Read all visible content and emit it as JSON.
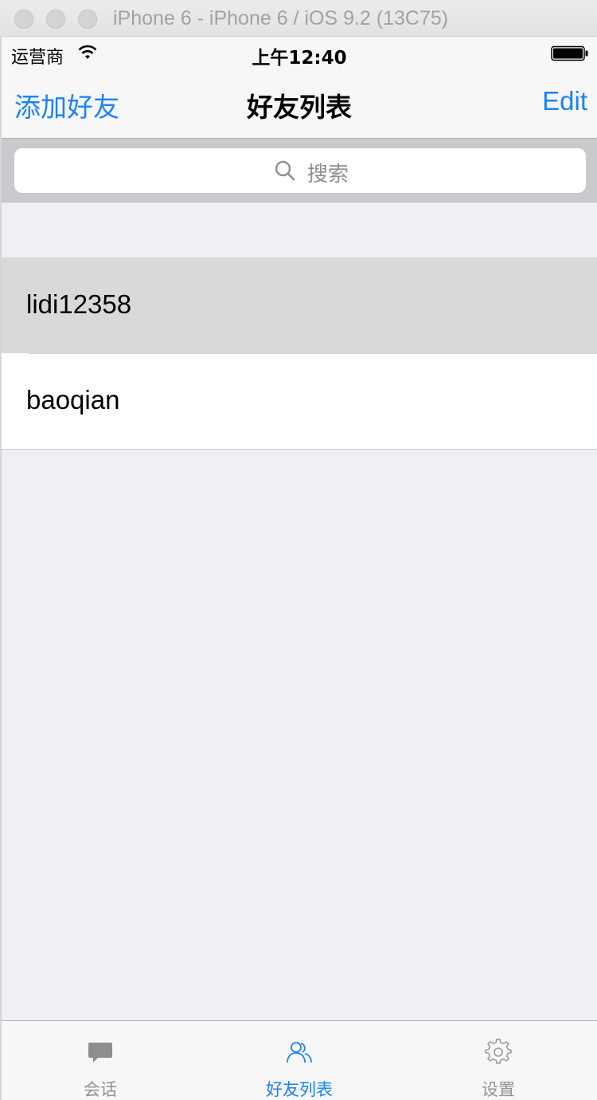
{
  "window": {
    "title": "iPhone 6 - iPhone 6 / iOS 9.2 (13C75)"
  },
  "statusbar": {
    "carrier": "运营商",
    "time": "上午12:40"
  },
  "navbar": {
    "left_label": "添加好友",
    "title": "好友列表",
    "right_label": "Edit"
  },
  "search": {
    "placeholder": "搜索"
  },
  "friends": [
    {
      "name": "lidi12358",
      "selected": true
    },
    {
      "name": "baoqian",
      "selected": false
    }
  ],
  "tabbar": {
    "tabs": [
      {
        "label": "会话",
        "icon": "chat-bubble-icon",
        "active": false
      },
      {
        "label": "好友列表",
        "icon": "contacts-icon",
        "active": true
      },
      {
        "label": "设置",
        "icon": "gear-icon",
        "active": false
      }
    ]
  },
  "colors": {
    "accent": "#1a82fb",
    "selected_row": "#d9d9d9",
    "background": "#efeff4"
  }
}
